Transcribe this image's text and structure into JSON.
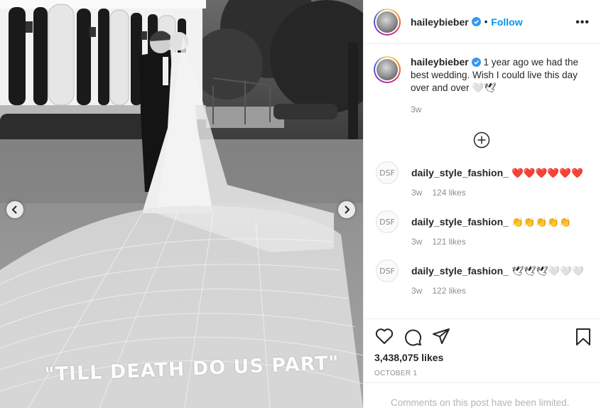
{
  "post": {
    "username": "haileybieber",
    "follow_label": "Follow",
    "separator": "•",
    "more_label": "•••",
    "veil_text": "\"TILL DEATH DO US PART\"",
    "caption": {
      "username": "haileybieber",
      "text": "1 year ago we had the best wedding. Wish I could live this day over and over 🤍🕊",
      "time": "3w"
    },
    "comments": [
      {
        "avatar_text": "DSF",
        "username": "daily_style_fashion_",
        "text": "❤️❤️❤️❤️❤️❤️",
        "time": "3w",
        "likes": "124 likes"
      },
      {
        "avatar_text": "DSF",
        "username": "daily_style_fashion_",
        "text": "👏👏👏👏👏",
        "time": "3w",
        "likes": "121 likes"
      },
      {
        "avatar_text": "DSF",
        "username": "daily_style_fashion_",
        "text": "🕊🕊🕊🤍🤍🤍",
        "time": "3w",
        "likes": "122 likes"
      }
    ],
    "likes": "3,438,075 likes",
    "date": "OCTOBER 1",
    "comments_limited": "Comments on this post have been limited."
  },
  "icons": [
    "chevron-left-icon",
    "chevron-right-icon",
    "verified-icon",
    "more-icon",
    "load-more-plus-icon",
    "heart-icon",
    "comment-icon",
    "share-icon",
    "bookmark-icon"
  ],
  "colors": {
    "follow": "#0095f6",
    "verified": "#3897f0",
    "muted": "#8e8e8e"
  }
}
